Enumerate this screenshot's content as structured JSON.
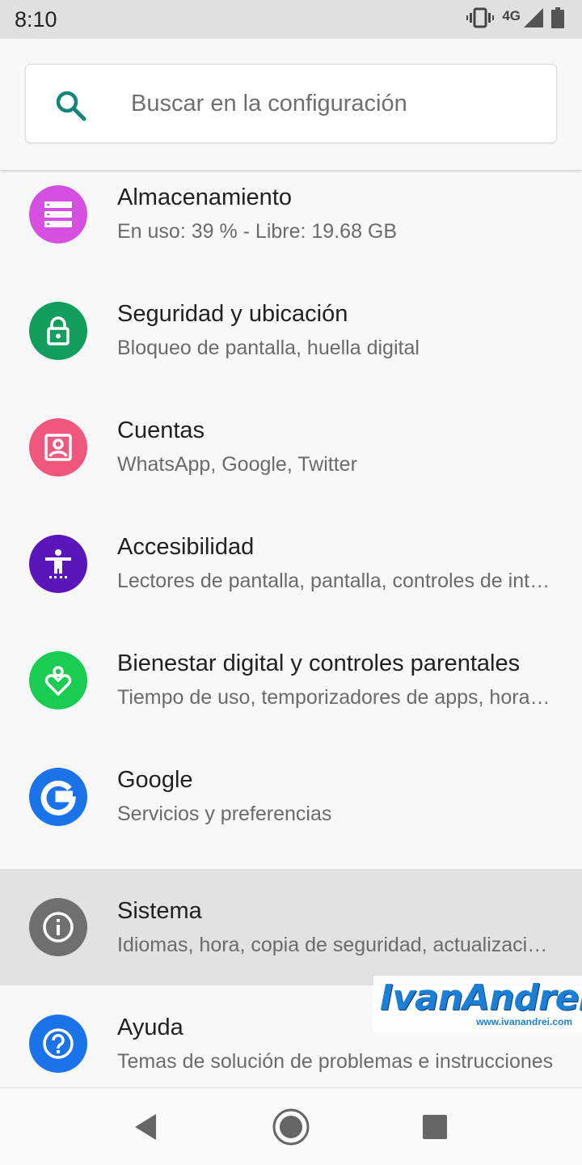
{
  "status_bar": {
    "time": "8:10",
    "network": "4G",
    "icons": [
      "vibrate-icon",
      "signal-icon",
      "battery-icon"
    ]
  },
  "search": {
    "placeholder": "Buscar en la configuración",
    "icon": "search-icon"
  },
  "settings": [
    {
      "title": "Almacenamiento",
      "subtitle": "En uso: 39 % - Libre: 19.68 GB",
      "icon": "storage-icon",
      "color": "#d54fe0"
    },
    {
      "title": "Seguridad y ubicación",
      "subtitle": "Bloqueo de pantalla, huella digital",
      "icon": "lock-icon",
      "color": "#149e5e"
    },
    {
      "title": "Cuentas",
      "subtitle": "WhatsApp, Google, Twitter",
      "icon": "account-icon",
      "color": "#f0577d"
    },
    {
      "title": "Accesibilidad",
      "subtitle": "Lectores de pantalla, pantalla, controles de interacción",
      "icon": "accessibility-icon",
      "color": "#5a16b8"
    },
    {
      "title": "Bienestar digital y controles parentales",
      "subtitle": "Tiempo de uso, temporizadores de apps, hora de dormir",
      "icon": "wellbeing-icon",
      "color": "#1bcc52"
    },
    {
      "title": "Google",
      "subtitle": "Servicios y preferencias",
      "icon": "google-icon",
      "color": "#1a73e8"
    },
    {
      "title": "Sistema",
      "subtitle": "Idiomas, hora, copia de seguridad, actualizaciones",
      "icon": "info-icon",
      "color": "#6f6f6f"
    },
    {
      "title": "Ayuda",
      "subtitle": "Temas de solución de problemas e instrucciones",
      "icon": "help-icon",
      "color": "#1a73e8"
    }
  ],
  "watermark": {
    "text": "IvanAndrei",
    "url": "www.ivanandrei.com"
  },
  "nav": {
    "icons": [
      "back-icon",
      "home-icon",
      "recents-icon"
    ]
  }
}
